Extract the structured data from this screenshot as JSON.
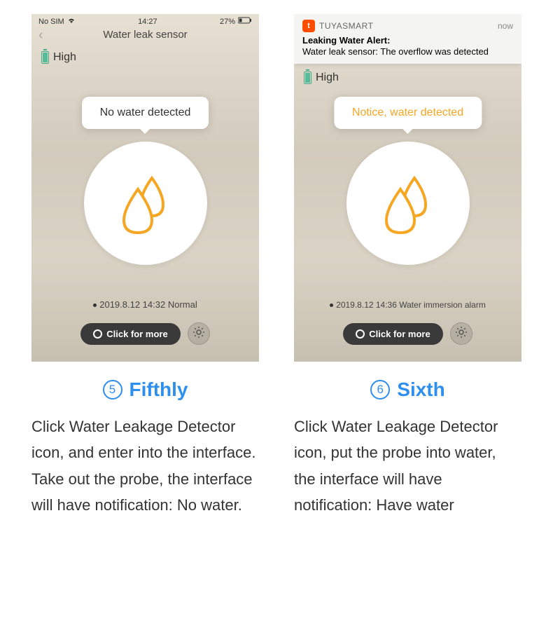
{
  "left": {
    "status": {
      "sim": "No SIM",
      "time": "14:27",
      "battery": "27%"
    },
    "header": {
      "title": "Water leak sensor"
    },
    "battery": {
      "label": "High"
    },
    "tooltip": "No water detected",
    "log": {
      "ts": "2019.8.12 14:32",
      "state": "Normal"
    },
    "button": "Click for more",
    "step": {
      "num": "5",
      "label": "Fifthly"
    },
    "desc": "Click Water Leakage Detector icon, and enter into the interface. Take out the probe, the interface will have notification: No water."
  },
  "right": {
    "notification": {
      "app": "TUYASMART",
      "time": "now",
      "title": "Leaking Water Alert:",
      "body": "Water leak sensor: The overflow was detected"
    },
    "battery": {
      "label": "High"
    },
    "tooltip": "Notice, water detected",
    "log": {
      "ts": "2019.8.12 14:36",
      "state": "Water immersion alarm"
    },
    "button": "Click for more",
    "step": {
      "num": "6",
      "label": "Sixth"
    },
    "desc": "Click Water Leakage Detector icon, put the probe into water, the interface will have notification: Have water"
  }
}
